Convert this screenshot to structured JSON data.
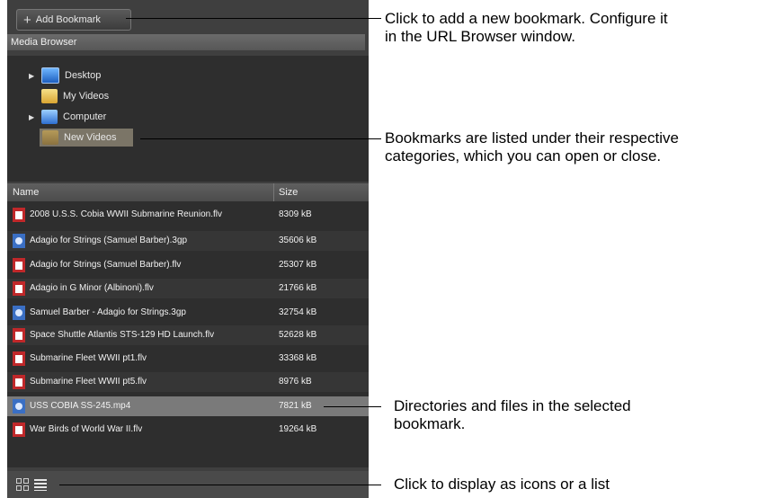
{
  "toolbar": {
    "add_bookmark_label": "Add Bookmark"
  },
  "media_browser": {
    "header": "Media Browser",
    "tree": [
      {
        "label": "Desktop",
        "icon": "desktop-icon"
      },
      {
        "label": "My Videos",
        "icon": "folder-video-icon"
      },
      {
        "label": "Computer",
        "icon": "computer-icon"
      },
      {
        "label": "New Videos",
        "icon": "folder-icon",
        "selected": true
      }
    ]
  },
  "file_list": {
    "columns": {
      "name": "Name",
      "size": "Size"
    },
    "rows": [
      {
        "name": "2008 U.S.S. Cobia WWII Submarine Reunion.flv",
        "size": "8309 kB",
        "icon": "flv-file-icon"
      },
      {
        "name": "Adagio for Strings (Samuel Barber).3gp",
        "size": "35606 kB",
        "icon": "3gp-file-icon"
      },
      {
        "name": "Adagio for Strings (Samuel Barber).flv",
        "size": "25307 kB",
        "icon": "flv-file-icon"
      },
      {
        "name": "Adagio in G Minor (Albinoni).flv",
        "size": "21766 kB",
        "icon": "flv-file-icon"
      },
      {
        "name": "Samuel Barber - Adagio for Strings.3gp",
        "size": "32754 kB",
        "icon": "3gp-file-icon"
      },
      {
        "name": "Space Shuttle Atlantis STS-129 HD Launch.flv",
        "size": "52628 kB",
        "icon": "flv-file-icon"
      },
      {
        "name": "Submarine Fleet WWII pt1.flv",
        "size": "33368 kB",
        "icon": "flv-file-icon"
      },
      {
        "name": "Submarine Fleet WWII pt5.flv",
        "size": "8976 kB",
        "icon": "flv-file-icon"
      },
      {
        "name": "USS COBIA SS-245.mp4",
        "size": "7821 kB",
        "icon": "mp4-file-icon",
        "selected": true
      },
      {
        "name": "War Birds of World War II.flv",
        "size": "19264 kB",
        "icon": "flv-file-icon"
      }
    ]
  },
  "footer": {
    "icons": [
      "grid-view-icon",
      "list-view-icon"
    ]
  },
  "callouts": {
    "add_bookmark": [
      "Click to add a new bookmark. Configure it",
      "in the URL Browser window."
    ],
    "bookmarks": [
      "Bookmarks are listed under their respective",
      "categories, which you can open or close."
    ],
    "directories": [
      "Directories and files in the selected",
      "bookmark."
    ],
    "view_mode": [
      "Click to display as icons or a list"
    ]
  },
  "colors": {
    "panel": "#3f3f3f",
    "list_bg": "#2e2e2e",
    "selected_row": "#7a7a7a",
    "file_red": "#c0282a",
    "file_blue": "#3a6fc4"
  }
}
